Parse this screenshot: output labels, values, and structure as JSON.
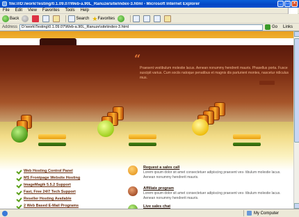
{
  "window": {
    "title": "file:///D:/work/Testing/0.1.09.07/Web-a.90L_Ranuze/site/index-3.html - Microsoft Internet Explorer",
    "min": "_",
    "max": "□",
    "close": "×"
  },
  "menu": [
    "File",
    "Edit",
    "View",
    "Favorites",
    "Tools",
    "Help"
  ],
  "toolbar": {
    "back": "Back",
    "search": "Search",
    "favorites": "Favorites"
  },
  "address": {
    "label": "Address",
    "url": "D:\\work\\Testing\\0.1.09.07\\Web-a.90L_Ranuze\\site\\index-3.html",
    "go": "Go",
    "links": "Links"
  },
  "hero": {
    "quote_mark": "“",
    "text": "Praesent vestibulum molestie lacus. Aenean nonummy hendrerit mauris. Phasellus porta. Fusce suscipit varius. Cum sociis natoque penatibus et magnis dis parturient montes, nascetur ridiculus mus."
  },
  "links": [
    "Web Hosting Control Panel",
    "MS Frontpage Website Hosting",
    "ImageMagik 5.5.2 Support",
    "Fast, Free 24/7 Tech Support",
    "Reseller Hosting Available",
    "2 Web Based E-Mail Programs"
  ],
  "features": [
    {
      "title": "Request a sales call",
      "text": "Lorem ipsum dolor sit amet consectetuer adipiscing praesent ves- tibulum molestie lacus. Aenean nonummy hendrerit mauris.",
      "color": "#e89020"
    },
    {
      "title": "Affiliate program",
      "text": "Lorem ipsum dolor sit amet consectetuer adipiscing praesent ves- tibulum molestie lacus. Aenean nonummy hendrerit mauris.",
      "color": "#b04818"
    },
    {
      "title": "Live sales chat",
      "text": "",
      "color": "#5aa018"
    }
  ],
  "status": {
    "zone": "My Computer"
  }
}
